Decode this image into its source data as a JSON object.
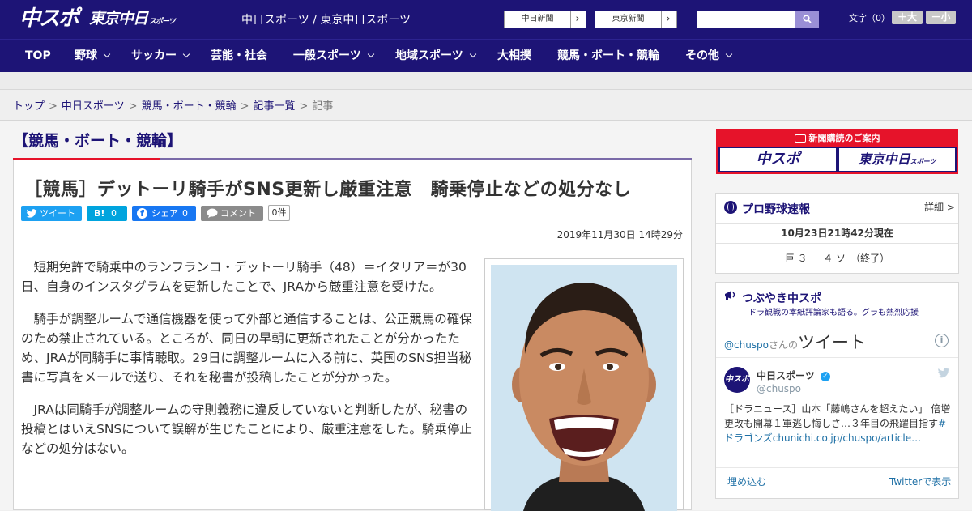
{
  "header": {
    "logo_primary": "中スポ",
    "logo_secondary": "東京中日",
    "logo_secondary_small": "スポーツ",
    "site_title": "中日スポーツ / 東京中日スポーツ",
    "site_buttons": [
      {
        "label": "中日新聞",
        "arrow": "›"
      },
      {
        "label": "東京新聞",
        "arrow": "›"
      }
    ],
    "search_placeholder": "",
    "fontsize_label": "文字（0）",
    "font_increase": "＋大",
    "font_decrease": "－小"
  },
  "nav": {
    "items": [
      {
        "label": "TOP",
        "dropdown": false
      },
      {
        "label": "野球",
        "dropdown": true
      },
      {
        "label": "サッカー",
        "dropdown": true
      },
      {
        "label": "芸能・社会",
        "dropdown": false
      },
      {
        "label": "一般スポーツ",
        "dropdown": true
      },
      {
        "label": "地域スポーツ",
        "dropdown": true
      },
      {
        "label": "大相撲",
        "dropdown": false
      },
      {
        "label": "競馬・ボート・競輪",
        "dropdown": false
      },
      {
        "label": "その他",
        "dropdown": true
      }
    ]
  },
  "breadcrumb": {
    "items": [
      "トップ",
      "中日スポーツ",
      "競馬・ボート・競輪",
      "記事一覧",
      "記事"
    ],
    "separator": ">"
  },
  "category": "【競馬・ボート・競輪】",
  "article": {
    "headline": "［競馬］デットーリ騎手がSNS更新し厳重注意　騎乗停止などの処分なし",
    "share": {
      "tweet": "ツイート",
      "hatena_icon": "B!",
      "hatena_count": "0",
      "facebook": "シェア",
      "facebook_count": "0",
      "comment": "コメント",
      "comment_count": "0件"
    },
    "date": "2019年11月30日 14時29分",
    "paragraphs": [
      "短期免許で騎乗中のランフランコ・デットーリ騎手（48）＝イタリア＝が30日、自身のインスタグラムを更新したことで、JRAから厳重注意を受けた。",
      "騎手が調整ルームで通信機器を使って外部と通信することは、公正競馬の確保のため禁止されている。ところが、同日の早朝に更新されたことが分かったため、JRAが同騎手に事情聴取。29日に調整ルームに入る前に、英国のSNS担当秘書に写真をメールで送り、それを秘書が投稿したことが分かった。",
      "JRAは同騎手が調整ルームの守則義務に違反していないと判断したが、秘書の投稿とはいえSNSについて誤解が生じたことにより、厳重注意をした。騎乗停止などの処分はない。"
    ]
  },
  "sidebar": {
    "promo": {
      "title": "新聞購読のご案内",
      "logo_left": "中スポ",
      "logo_right": "東京中日",
      "logo_right_small": "スポーツ"
    },
    "baseball": {
      "title": "プロ野球速報",
      "detail": "詳細 >",
      "timestamp": "10月23日21時42分現在",
      "score": "巨 ３ － ４ ソ　（終了）"
    },
    "tweets": {
      "title": "つぶやき中スポ",
      "subtitle": "ドラ観戦の本紙評論家も語る。グラも熱烈応援",
      "handle_prefix": "@chuspo",
      "handle_suffix": "さんの",
      "heading": "ツイート",
      "account_name": "中日スポーツ",
      "account_handle": "@chuspo",
      "tweet_text": "［ドラニュース］山本「藤嶋さんを超えたい」 倍増更改も開幕１軍逃し悔しさ…３年目の飛躍目指す",
      "tweet_link": "#ドラゴンズ",
      "tweet_url": "chunichi.co.jp/chuspo/article…",
      "embed": "埋め込む",
      "view_on_twitter": "Twitterで表示"
    }
  },
  "colors": {
    "brand_navy": "#1d1476",
    "accent_red": "#e6132a",
    "twitter_blue": "#1da1f2",
    "facebook_blue": "#1877f2",
    "hatena_blue": "#00a4de"
  }
}
